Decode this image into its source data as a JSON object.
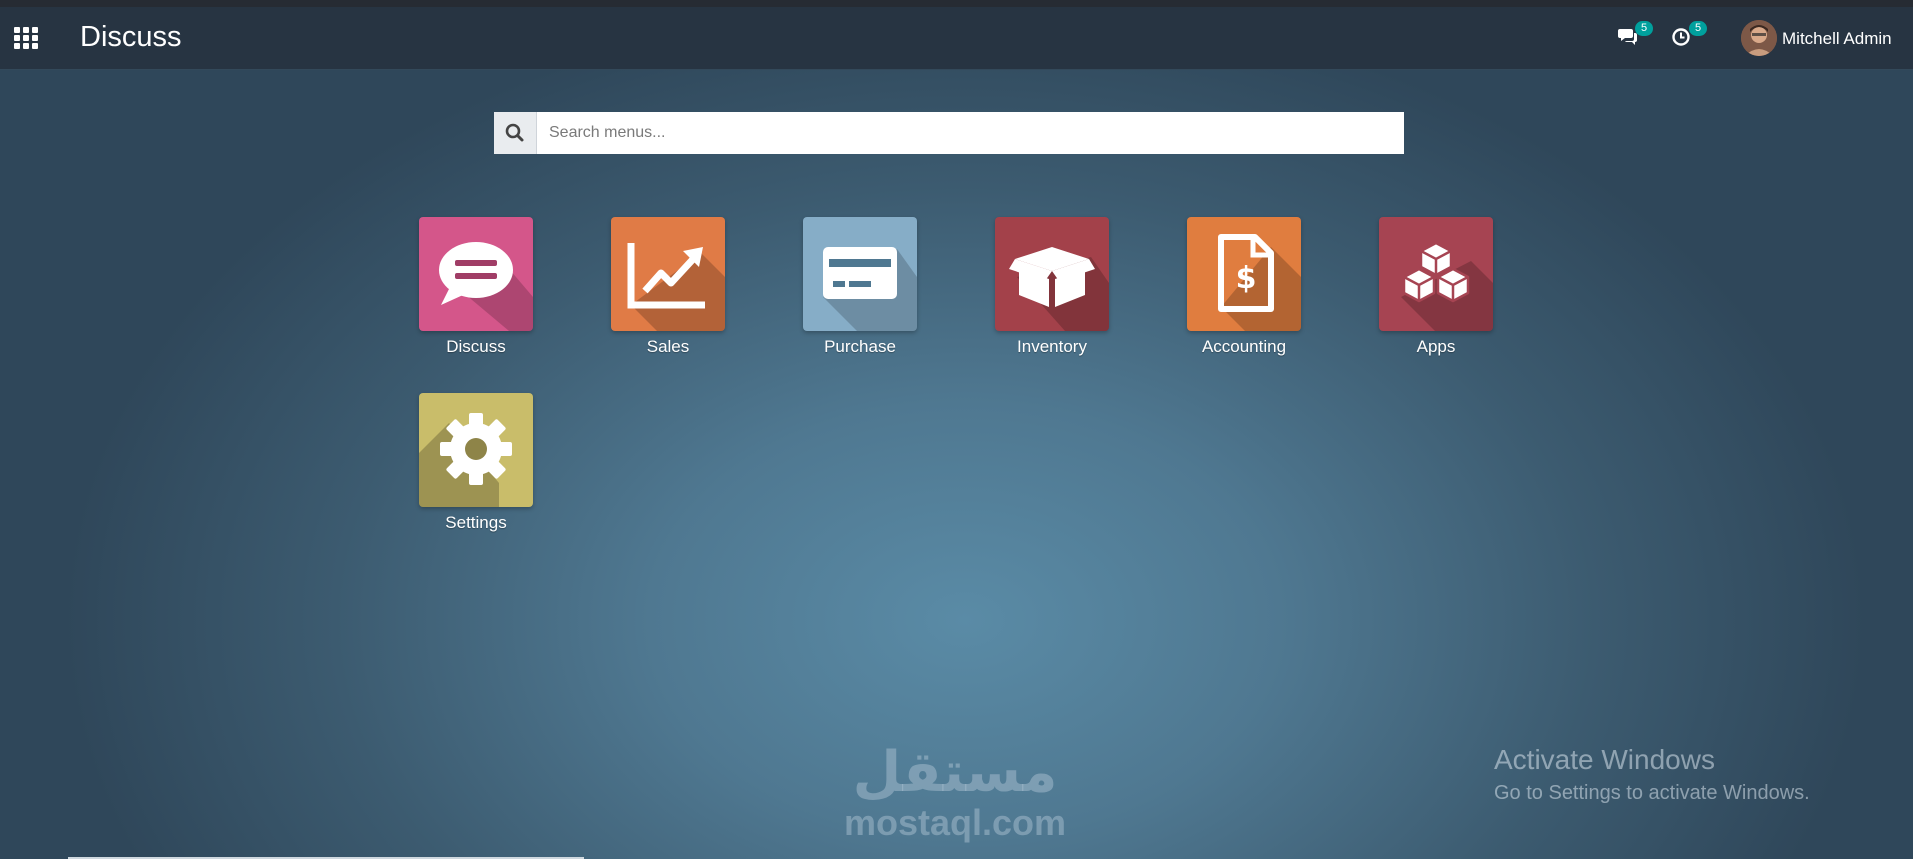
{
  "navbar": {
    "app_title": "Discuss",
    "messages_count": "5",
    "activities_count": "5",
    "user_name": "Mitchell Admin"
  },
  "search": {
    "placeholder": "Search menus..."
  },
  "apps": [
    {
      "label": "Discuss",
      "color": "#d4568a",
      "icon": "chat-bubble-icon"
    },
    {
      "label": "Sales",
      "color": "#e07b46",
      "icon": "trend-chart-icon"
    },
    {
      "label": "Purchase",
      "color": "#86adc7",
      "icon": "credit-card-icon"
    },
    {
      "label": "Inventory",
      "color": "#a3414a",
      "icon": "open-box-icon"
    },
    {
      "label": "Accounting",
      "color": "#e07d3f",
      "icon": "invoice-dollar-icon"
    },
    {
      "label": "Apps",
      "color": "#a64452",
      "icon": "cubes-icon"
    },
    {
      "label": "Settings",
      "color": "#c9bd6a",
      "icon": "gear-icon"
    }
  ],
  "watermark": {
    "arabic": "مستقل",
    "latin": "mostaql.com"
  },
  "os_notice": {
    "title": "Activate Windows",
    "subtitle": "Go to Settings to activate Windows."
  }
}
